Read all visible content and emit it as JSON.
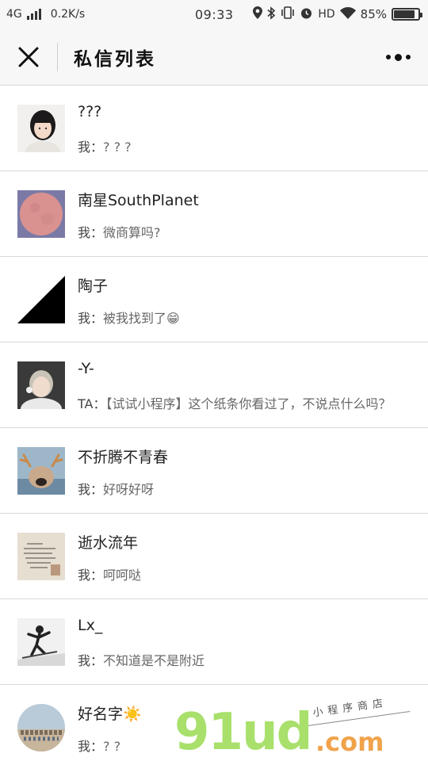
{
  "status_bar": {
    "network": "4G",
    "speed": "0.2K/s",
    "time": "09:33",
    "hd": "HD",
    "battery": "85%",
    "battery_level": 0.85,
    "icons": [
      "signal-icon",
      "location-icon",
      "bluetooth-icon",
      "vibrate-icon",
      "alarm-icon",
      "wifi-icon",
      "battery-icon"
    ]
  },
  "header": {
    "title": "私信列表",
    "close_icon": "close-icon",
    "more_icon": "more-icon"
  },
  "chats": [
    {
      "name": "???",
      "prefix": "我：",
      "message": "? ? ?",
      "emoji": "",
      "avatar": "avatar-girl-white"
    },
    {
      "name": "南星SouthPlanet",
      "prefix": "我：",
      "message": "微商算吗?",
      "emoji": "",
      "avatar": "avatar-pink-moon"
    },
    {
      "name": "陶子",
      "prefix": "我：",
      "message": "被我找到了",
      "emoji": "😁",
      "avatar": "avatar-black-triangle"
    },
    {
      "name": "-Y-",
      "prefix": "TA：",
      "message": "【试试小程序】这个纸条你看过了，不说点什么吗？",
      "emoji": "",
      "avatar": "avatar-short-hair"
    },
    {
      "name": "不折腾不青春",
      "prefix": "我：",
      "message": "好呀好呀",
      "emoji": "",
      "avatar": "avatar-dog-antlers"
    },
    {
      "name": "逝水流年",
      "prefix": "我：",
      "message": "呵呵哒",
      "emoji": "",
      "avatar": "avatar-handwritten-note"
    },
    {
      "name": "Lx_",
      "prefix": "我：",
      "message": "不知道是不是附近",
      "emoji": "",
      "avatar": "avatar-skier"
    },
    {
      "name": "好名字",
      "name_emoji": "☀️",
      "prefix": "我：",
      "message": "? ?",
      "emoji": "",
      "avatar": "avatar-group-photo"
    }
  ],
  "watermark": {
    "logo": "91ud",
    "domain": ".com",
    "tagline": "小程序商店"
  },
  "colors": {
    "bar_bg": "#f7f7f7",
    "divider": "#d9d9d9",
    "watermark_green": "#a8e06b",
    "watermark_orange": "#f0a34b"
  }
}
